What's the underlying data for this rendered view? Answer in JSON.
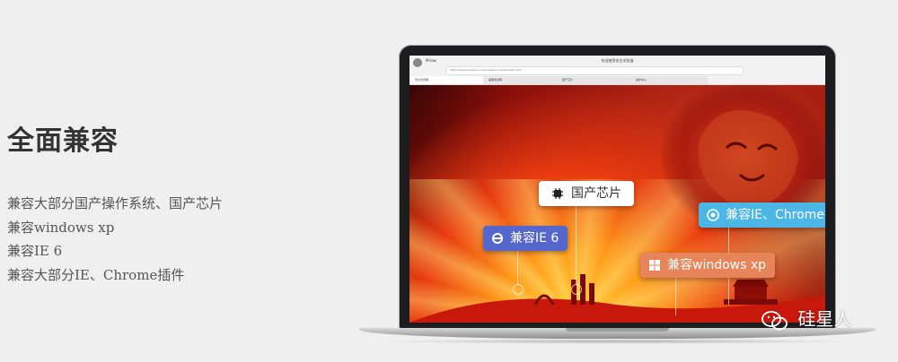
{
  "headline": "全面兼容",
  "features": [
    "兼容大部分国产操作系统、国产芯片",
    "兼容windows xp",
    "兼容IE 6",
    "兼容大部分IE、Chrome插件"
  ],
  "browser": {
    "user_name": "Miraw",
    "window_title": "欢迎使用安全浏览器",
    "address": "http://www.example.com/browser/compat/index.html",
    "tabs": [
      "安全浏览器",
      "兼容性说明",
      "国产芯片",
      "插件中心"
    ]
  },
  "labels": {
    "chip": "国产芯片",
    "ie": "兼容IE 6",
    "windows": "兼容windows xp",
    "chrome": "兼容IE、Chrome插件"
  },
  "watermark": "硅星人",
  "colors": {
    "ie_label": "#5566cc",
    "windows_label": "#e8845a",
    "chrome_label": "#4cb7e6"
  }
}
